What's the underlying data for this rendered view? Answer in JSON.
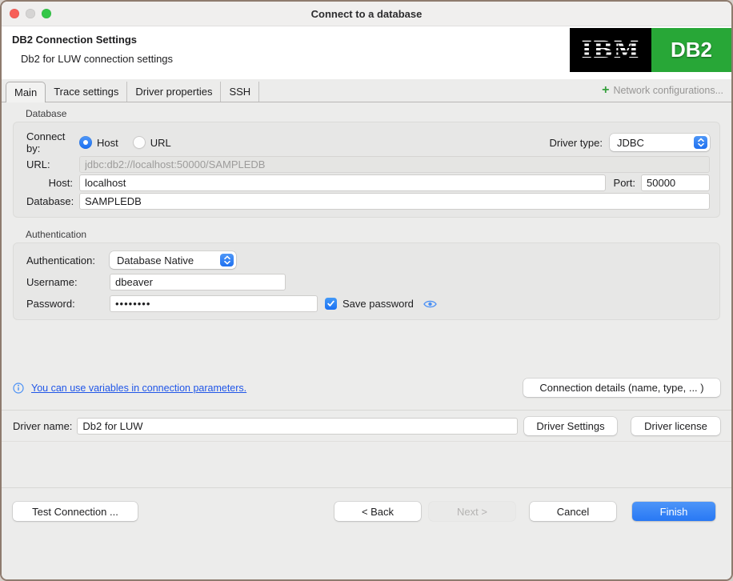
{
  "titlebar": {
    "title": "Connect to a database"
  },
  "header": {
    "title": "DB2 Connection Settings",
    "subtitle": "Db2 for LUW connection settings",
    "logo_ibm": "IBM",
    "logo_db2": "DB2"
  },
  "tabbar": {
    "tabs": [
      {
        "label": "Main"
      },
      {
        "label": "Trace settings"
      },
      {
        "label": "Driver properties"
      },
      {
        "label": "SSH"
      }
    ],
    "selected_tab": "Main",
    "plus": "+",
    "network_configurations": "Network configurations..."
  },
  "database": {
    "group_label": "Database",
    "connect_by_label": "Connect by:",
    "host_option": "Host",
    "url_option": "URL",
    "driver_type_label": "Driver type:",
    "driver_type": "JDBC",
    "url_label": "URL:",
    "url": "jdbc:db2://localhost:50000/SAMPLEDB",
    "host_label": "Host:",
    "host": "localhost",
    "port_label": "Port:",
    "port": "50000",
    "database_label": "Database:",
    "database": "SAMPLEDB"
  },
  "authentication": {
    "group_label": "Authentication",
    "auth_label": "Authentication:",
    "auth_type": "Database Native",
    "username_label": "Username:",
    "username": "dbeaver",
    "password_label": "Password:",
    "password_masked": "••••••••",
    "save_password_label": "Save password"
  },
  "info": {
    "link": "You can use variables in connection parameters.",
    "details_button": "Connection details (name, type, ... )"
  },
  "driver": {
    "label": "Driver name:",
    "name": "Db2 for LUW",
    "settings_button": "Driver Settings",
    "license_button": "Driver license"
  },
  "actions": {
    "test": "Test Connection ...",
    "back": "< Back",
    "next": "Next >",
    "cancel": "Cancel",
    "finish": "Finish"
  },
  "colors": {
    "accent_blue": "#2a7cf7",
    "link_blue": "#2056e8",
    "logo_green": "#28a737",
    "plus_green": "#35a03c",
    "window_border": "#8e7b6e"
  }
}
